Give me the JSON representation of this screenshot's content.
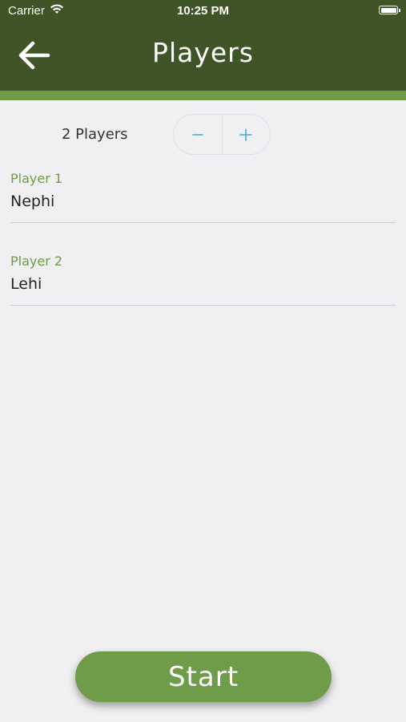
{
  "status_bar": {
    "carrier": "Carrier",
    "time": "10:25 PM"
  },
  "header": {
    "title": "Players"
  },
  "players_count": {
    "label": "2 Players",
    "minus": "−",
    "plus": "+"
  },
  "players": [
    {
      "label": "Player 1",
      "name": "Nephi"
    },
    {
      "label": "Player 2",
      "name": "Lehi"
    }
  ],
  "actions": {
    "start": "Start"
  },
  "colors": {
    "header": "#3f5528",
    "accent": "#6f9c48",
    "stepper": "#4aa8d8"
  }
}
